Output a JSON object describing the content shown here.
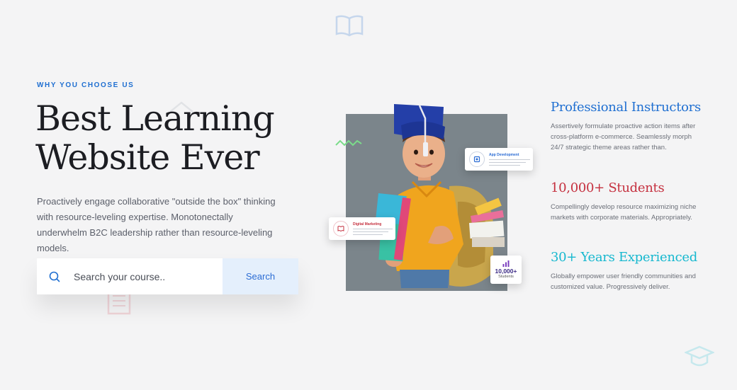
{
  "colors": {
    "background": "#f4f4f5",
    "accent_blue": "#1f6fd1",
    "accent_red": "#c5303f",
    "accent_cyan": "#16b8cf",
    "search_button_bg": "#e4effc"
  },
  "section": {
    "eyebrow": "WHY YOU CHOOSE US",
    "title_line1": "Best Learning",
    "title_line2": "Website Ever",
    "description": "Proactively engage collaborative \"outside the box\" thinking with resource-leveling expertise. Monotonectally underwhelm B2C leadership rather than resource-leveling models."
  },
  "search": {
    "icon": "search-icon",
    "placeholder": "Search your course..",
    "button_label": "Search"
  },
  "hero": {
    "cards": [
      {
        "title": "App Development",
        "icon": "app-development-icon"
      },
      {
        "title": "Digital Marketing",
        "icon": "book-icon"
      }
    ],
    "stat": {
      "value": "10,000+",
      "label": "Students",
      "icon": "bar-chart-icon"
    }
  },
  "features": [
    {
      "title": "Professional Instructors",
      "color": "#1f6fd1",
      "text": "Assertively formulate proactive action items after cross-platform e-commerce. Seamlessly morph 24/7 strategic theme areas rather than."
    },
    {
      "title": "10,000+ Students",
      "color": "#c5303f",
      "text": "Compellingly develop resource maximizing niche markets with corporate materials. Appropriately."
    },
    {
      "title": "30+ Years Experienced",
      "color": "#16b8cf",
      "text": "Globally empower user friendly communities and customized value. Progressively deliver."
    }
  ]
}
